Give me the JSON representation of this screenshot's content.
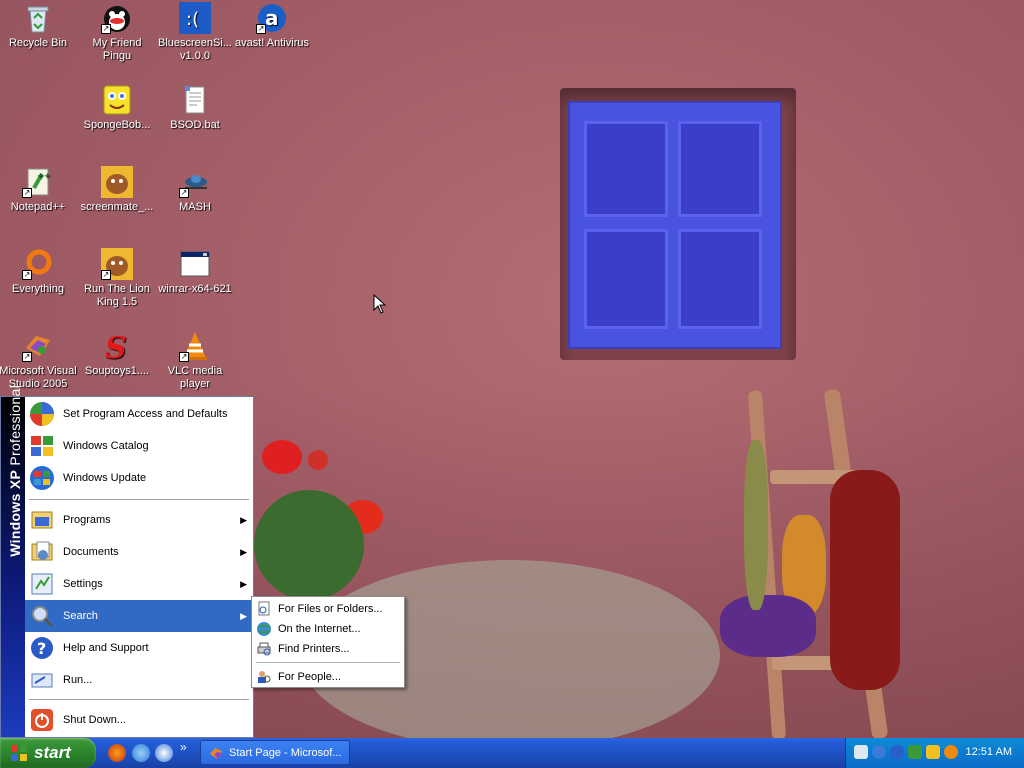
{
  "desktop": {
    "icons": [
      {
        "label": "Recycle Bin",
        "icon": "recycle-bin-icon"
      },
      {
        "label": "My Friend Pingu",
        "icon": "pingu-icon"
      },
      {
        "label": "BluescreenSi... v1.0.0",
        "icon": "bluescreen-icon"
      },
      {
        "label": "avast! Antivirus",
        "icon": "avast-icon"
      },
      {
        "label": "SpongeBob...",
        "icon": "spongebob-icon"
      },
      {
        "label": "BSOD.bat",
        "icon": "batch-file-icon"
      },
      {
        "label": "Notepad++",
        "icon": "notepadpp-icon"
      },
      {
        "label": "screenmate_...",
        "icon": "screenmate-icon"
      },
      {
        "label": "MASH",
        "icon": "mash-icon"
      },
      {
        "label": "Everything",
        "icon": "everything-icon"
      },
      {
        "label": "Run The Lion King 1.5",
        "icon": "lion-king-icon"
      },
      {
        "label": "winrar-x64-621",
        "icon": "winrar-installer-icon"
      },
      {
        "label": "Microsoft Visual Studio 2005",
        "icon": "visual-studio-icon"
      },
      {
        "label": "Souptoys1....",
        "icon": "souptoys-icon"
      },
      {
        "label": "VLC media player",
        "icon": "vlc-icon"
      }
    ]
  },
  "start_menu": {
    "side_banner": {
      "brand": "Windows XP",
      "edition": "Professional"
    },
    "top_items": [
      {
        "label": "Set Program Access and Defaults",
        "icon": "program-access-icon"
      },
      {
        "label": "Windows Catalog",
        "icon": "windows-catalog-icon"
      },
      {
        "label": "Windows Update",
        "icon": "windows-update-icon"
      }
    ],
    "main_items": [
      {
        "label": "Programs",
        "icon": "programs-icon",
        "has_submenu": true
      },
      {
        "label": "Documents",
        "icon": "documents-icon",
        "has_submenu": true
      },
      {
        "label": "Settings",
        "icon": "settings-icon",
        "has_submenu": true
      },
      {
        "label": "Search",
        "icon": "search-icon",
        "has_submenu": true,
        "highlighted": true
      },
      {
        "label": "Help and Support",
        "icon": "help-icon",
        "has_submenu": false
      },
      {
        "label": "Run...",
        "icon": "run-icon",
        "has_submenu": false
      }
    ],
    "shutdown": {
      "label": "Shut Down...",
      "icon": "shutdown-icon"
    },
    "arrow_glyph": "▶"
  },
  "search_submenu": {
    "items": [
      {
        "label": "For Files or Folders...",
        "icon": "find-files-icon"
      },
      {
        "label": "On the Internet...",
        "icon": "internet-search-icon"
      },
      {
        "label": "Find Printers...",
        "icon": "find-printers-icon"
      },
      {
        "label": "For People...",
        "icon": "find-people-icon"
      }
    ]
  },
  "taskbar": {
    "start_label": "start",
    "quick_launch": [
      "firefox-icon",
      "ie-icon",
      "media-icon"
    ],
    "overflow_glyph": "»",
    "tasks": [
      {
        "label": "Start Page - Microsof...",
        "icon": "vs-start-page-icon"
      }
    ],
    "tray_icons": [
      "network-icon",
      "info-icon",
      "avast-tray-icon",
      "update-icon",
      "shield-icon",
      "search-tray-icon"
    ],
    "clock": "12:51 AM"
  },
  "colors": {
    "selection": "#316ac5",
    "taskbar": "#245edb",
    "start_button": "#2f8a2f",
    "tray": "#0b7ad0"
  }
}
